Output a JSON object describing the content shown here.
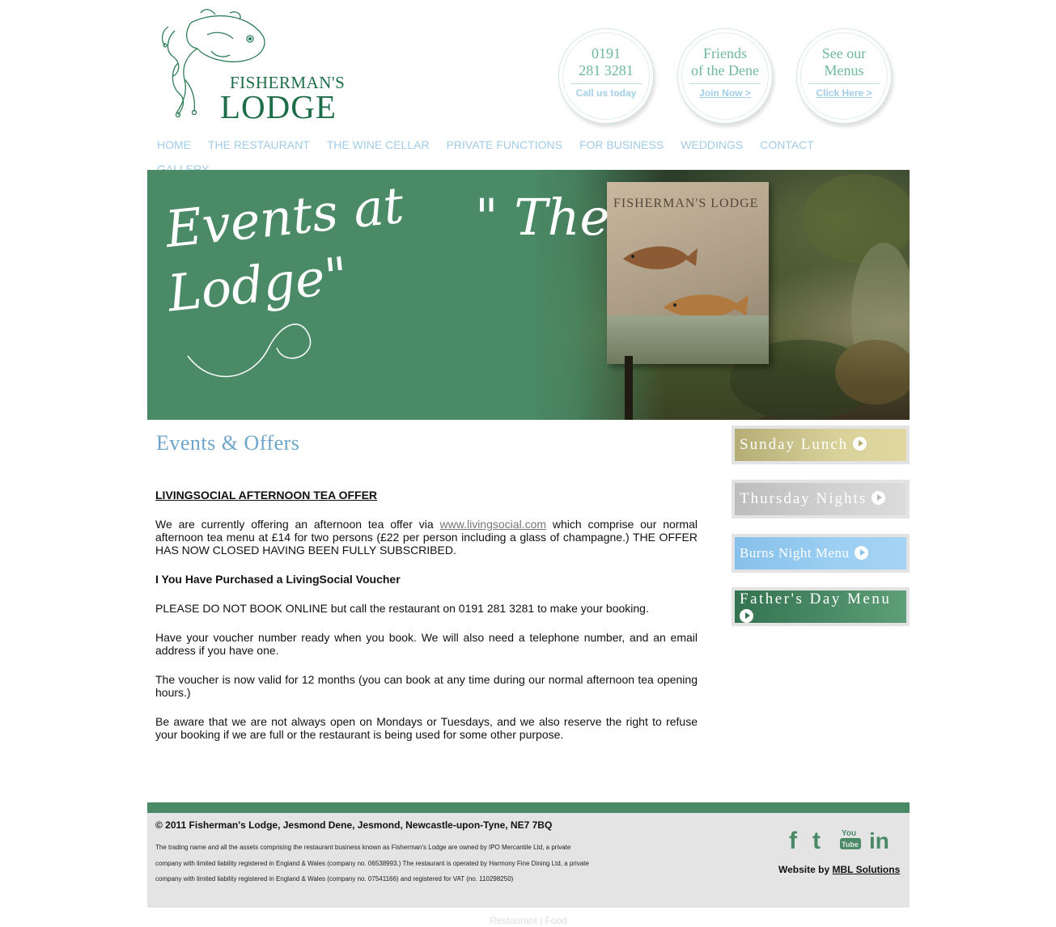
{
  "logo": {
    "top": "FISHERMAN'S",
    "bottom": "LODGE"
  },
  "circles": [
    {
      "line1": "0191",
      "line2": "281 3281",
      "link": "Call us today"
    },
    {
      "line1": "Friends",
      "line2": "of the Dene",
      "link": "Join Now >"
    },
    {
      "line1": "See our",
      "line2": "Menus",
      "link": "Click Here >"
    }
  ],
  "nav": [
    "HOME",
    "THE RESTAURANT",
    "THE WINE CELLAR",
    "PRIVATE FUNCTIONS",
    "FOR BUSINESS",
    "WEDDINGS",
    "CONTACT",
    "GALLERY"
  ],
  "banner": {
    "script_events": "Events at",
    "script_quote": "\" The",
    "script_lodge": "Lodge\"",
    "sign_text": "FISHERMAN'S   LODGE"
  },
  "main": {
    "heading": "Events & Offers",
    "offer_title": "LIVINGSOCIAL AFTERNOON TEA OFFER",
    "para1_before": "We are currently offering an afternoon tea offer via ",
    "para1_link": "www.livingsocial.com",
    "para1_after": " which comprise our normal afternoon tea menu at £14 for two persons (£22 per person including a glass of champagne.)  THE OFFER HAS NOW CLOSED HAVING BEEN FULLY SUBSCRIBED.",
    "sub_title": "I You Have Purchased a LivingSocial Voucher",
    "para2": "PLEASE DO NOT BOOK ONLINE but call the restaurant on 0191 281 3281 to make your booking.",
    "para3": "Have your voucher number ready when you book. We will also need a telephone number, and an email address if you have one.",
    "para4": "The voucher is now valid for 12 months (you can book at any time during our normal afternoon tea opening hours.)",
    "para5": "Be aware that we are not always open on Mondays or Tuesdays, and we also reserve the right to refuse your booking if we are full or the restaurant is being used for some other purpose."
  },
  "sidebar": [
    "Sunday Lunch",
    "Thursday Nights",
    "Burns Night Menu",
    "Father's Day Menu"
  ],
  "footer": {
    "copyright": "© 2011 Fisherman's Lodge, Jesmond Dene, Jesmond, Newcastle-upon-Tyne, NE7 7BQ",
    "legal_line1": "The trading name and all the assets comprising the restaurant business known as Fisherman's Lodge are owned by IPO Mercantile Ltd, a private",
    "legal_line2": "company with limited liability registered in England & Wales (company no. 06538993.) The restaurant is operated by Harmony Fine Dining Ltd, a private",
    "legal_line3": "company with limited liability registered in England & Wales (company no. 07541166) and registered for VAT (no. 110298250)",
    "credit_prefix": "Website by ",
    "credit_link": "MBL Solutions",
    "social": {
      "facebook": "f",
      "twitter": "t",
      "youtube_top": "You",
      "youtube_bottom": "Tube",
      "linkedin": "in"
    },
    "tags": "Restaurant | Food"
  },
  "colors": {
    "brand_green": "#4a8a66",
    "logo_green": "#1d6e48",
    "nav_blue": "#a2cbe6",
    "heading_blue": "#6da5ca"
  }
}
